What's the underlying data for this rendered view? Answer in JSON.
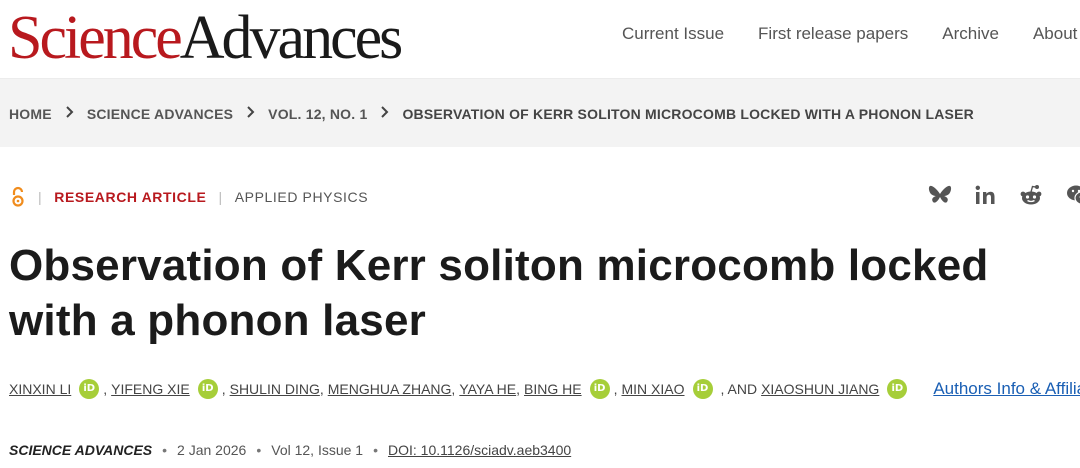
{
  "header": {
    "logo_science": "Science",
    "logo_advances": "Advances",
    "nav": [
      "Current Issue",
      "First release papers",
      "Archive",
      "About"
    ]
  },
  "breadcrumb": [
    "HOME",
    "SCIENCE ADVANCES",
    "VOL. 12, NO. 1",
    "OBSERVATION OF KERR SOLITON MICROCOMB LOCKED WITH A PHONON LASER"
  ],
  "article": {
    "type": "RESEARCH ARTICLE",
    "subject": "APPLIED PHYSICS",
    "title": "Observation of Kerr soliton microcomb locked with a phonon laser",
    "authors": [
      {
        "name": "XINXIN LI",
        "orcid": true
      },
      {
        "name": "YIFENG XIE",
        "orcid": true
      },
      {
        "name": "SHULIN DING",
        "orcid": false
      },
      {
        "name": "MENGHUA ZHANG",
        "orcid": false
      },
      {
        "name": "YAYA HE",
        "orcid": false
      },
      {
        "name": "BING HE",
        "orcid": true
      },
      {
        "name": "MIN XIAO",
        "orcid": true
      },
      {
        "name": "XIAOSHUN JIANG",
        "orcid": true
      }
    ],
    "and_text": ", AND",
    "orcid_label": "iD",
    "affiliations_link": "Authors Info & Affiliations",
    "journal": "SCIENCE ADVANCES",
    "date": "2 Jan 2026",
    "volume": "Vol 12, Issue 1",
    "doi": "DOI: 10.1126/sciadv.aeb3400"
  },
  "share_icons": [
    "bluesky-icon",
    "linkedin-icon",
    "reddit-icon",
    "wechat-icon"
  ],
  "colors": {
    "brand_red": "#b8191e",
    "orcid_green": "#a6ce39",
    "link_blue": "#1a5fb4",
    "open_access_orange": "#f08c1d"
  }
}
